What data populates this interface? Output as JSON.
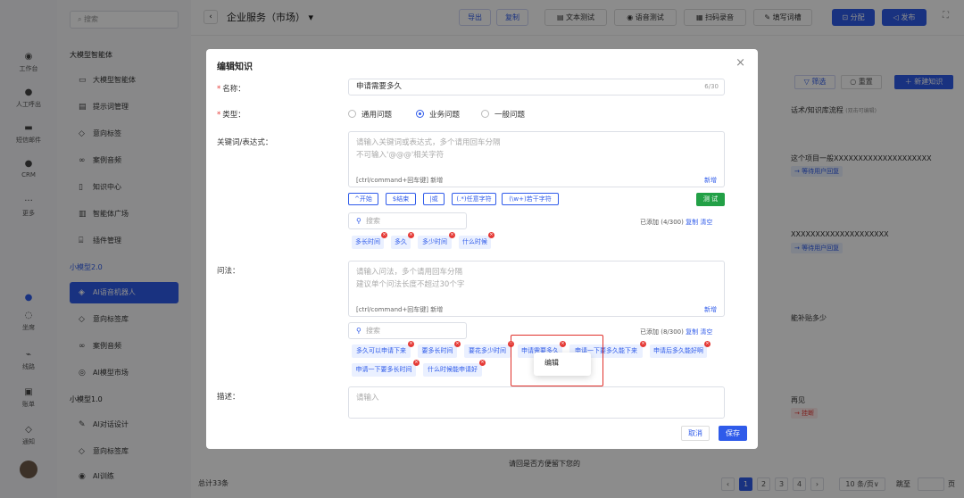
{
  "rail": {
    "items": [
      {
        "label": "工作台",
        "icon": "home-icon"
      },
      {
        "label": "人工呼出",
        "icon": "phone-icon"
      },
      {
        "label": "短信邮件",
        "icon": "message-icon"
      },
      {
        "label": "CRM",
        "icon": "crm-icon"
      },
      {
        "label": "更多",
        "icon": "more-icon"
      },
      {
        "label": "坐席",
        "icon": "seat-icon"
      },
      {
        "label": "线路",
        "icon": "line-icon"
      },
      {
        "label": "账单",
        "icon": "bill-icon"
      },
      {
        "label": "通知",
        "icon": "bell-icon"
      }
    ]
  },
  "sidebar": {
    "search_placeholder": "搜索",
    "groups": [
      {
        "title": "大模型智能体",
        "items": [
          "大模型智能体",
          "提示词管理",
          "意向标签",
          "案例音频",
          "知识中心",
          "智能体广场",
          "插件管理"
        ]
      },
      {
        "title": "小模型2.0",
        "items": [
          "AI语音机器人",
          "意向标签库",
          "案例音频",
          "AI模型市场"
        ]
      },
      {
        "title": "小模型1.0",
        "items": [
          "AI对话设计",
          "意向标签库",
          "AI训练"
        ]
      }
    ]
  },
  "topbar": {
    "title": "企业服务（市场）",
    "buttons": {
      "export": "导出",
      "copy": "复制",
      "text_test": "文本测试",
      "voice_test": "语音测试",
      "scan_record": "扫码录音",
      "fill_words": "填写词槽",
      "assign": "分配",
      "publish": "发布"
    }
  },
  "table_bg": {
    "filter": "筛选",
    "reset": "重置",
    "new_knowledge": "新建知识",
    "col_header": "话术/知识库流程",
    "col_header_hint": "(双击可编辑)",
    "rows": [
      {
        "text": "这个项目一般XXXXXXXXXXXXXXXXXXXX",
        "tag": "→ 等待用户回复"
      },
      {
        "text": "XXXXXXXXXXXXXXXXXXXX",
        "tag": "→ 等待用户回复"
      },
      {
        "text": "能补贴多少",
        "tag": ""
      },
      {
        "text": "再见",
        "tag": "→ 挂断"
      }
    ],
    "total": "总计33条",
    "hint_text": "请回是否方便留下您的",
    "pages": [
      "1",
      "2",
      "3",
      "4"
    ],
    "page_size": "10 条/页",
    "jump_label": "跳至",
    "page_unit": "页"
  },
  "modal": {
    "title": "编辑知识",
    "name_label": "名称：",
    "name_value": "申请需要多久",
    "name_count": "6/30",
    "type_label": "类型：",
    "types": [
      "通用问题",
      "业务问题",
      "一般问题"
    ],
    "type_selected": 1,
    "kw_label": "关键词/表达式：",
    "kw_placeholder_1": "请输入关键词或表达式，多个请用回车分隔",
    "kw_placeholder_2": "不可输入'@@@'相关字符",
    "kw_hint": "[ctrl/command+回车键] 新增",
    "add": "新增",
    "regex_buttons": [
      "^开始",
      "$结束",
      "|或",
      "(.*)任意字符",
      "(\\w+)若干字符"
    ],
    "test": "测 试",
    "search_placeholder": "搜索",
    "kw_added": "已添加 (4/300)",
    "copy": "复制",
    "clear": "清空",
    "kw_tags": [
      "多长时间",
      "多久",
      "多少时间",
      "什么时候"
    ],
    "q_label": "问法：",
    "q_placeholder_1": "请输入问法，多个请用回车分隔",
    "q_placeholder_2": "建议单个问法长度不超过30个字",
    "q_added": "已添加 (8/300)",
    "q_tags": [
      "多久可以申请下来",
      "要多长时间",
      "要花多少时间",
      "申请需要多久",
      "申请一下要多久能下来",
      "申请后多久能好啊",
      "申请一下要多长时间",
      "什么时候能申请好"
    ],
    "context_menu": "编辑",
    "desc_label": "描述：",
    "desc_placeholder": "请输入",
    "cancel": "取消",
    "save": "保存"
  },
  "colors": {
    "primary": "#2f5bea",
    "danger": "#e53935",
    "highlight_box": "#e0302a"
  }
}
